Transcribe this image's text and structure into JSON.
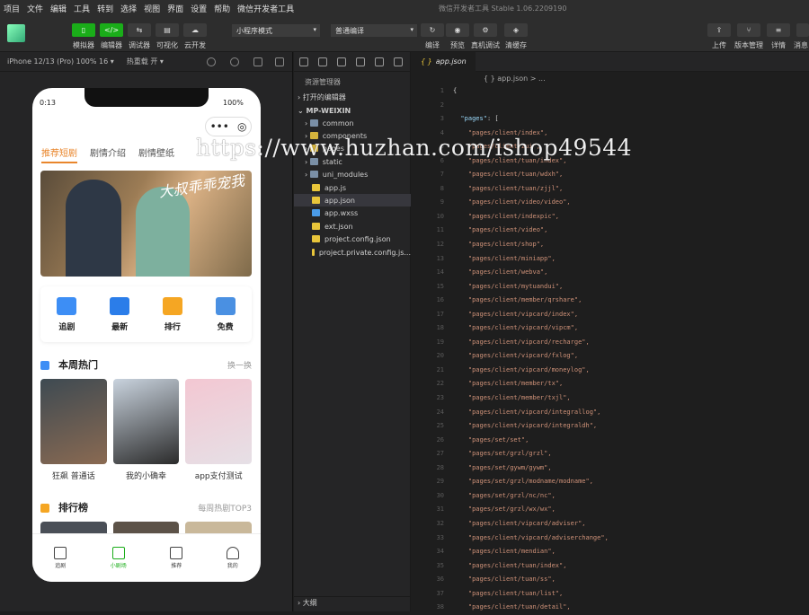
{
  "menu": [
    "项目",
    "文件",
    "编辑",
    "工具",
    "转到",
    "选择",
    "视图",
    "界面",
    "设置",
    "帮助",
    "微信开发者工具"
  ],
  "window_title": "微信开发者工具 Stable 1.06.2209190",
  "toolbar": {
    "left_labels": [
      "模拟器",
      "编辑器",
      "调试器",
      "可视化",
      "云开发"
    ],
    "mode_select": "小程序模式",
    "compile_select": "普通编译",
    "mid_labels": [
      "编译",
      "预览",
      "真机调试",
      "清缓存"
    ],
    "right_labels": [
      "上传",
      "版本管理",
      "详情",
      "消息"
    ]
  },
  "simulator": {
    "device": "iPhone 12/13 (Pro) 100% 16 ▾",
    "hot_reload": "热重载 开 ▾",
    "time": "0:13",
    "battery": "100%",
    "tabs": [
      "推荐短剧",
      "剧情介绍",
      "剧情壁纸"
    ],
    "banner_text": "大叔乖乖宠我",
    "quick": [
      {
        "label": "追剧",
        "color": "#3d8ef5"
      },
      {
        "label": "最新",
        "color": "#2b7de9"
      },
      {
        "label": "排行",
        "color": "#f5a623"
      },
      {
        "label": "免费",
        "color": "#4a90e2"
      }
    ],
    "weekly_title": "本周热门",
    "weekly_more": "换一换",
    "cards": [
      {
        "caption": "狂飙 普通话",
        "c1": "#3e4a52",
        "c2": "#8a6a52"
      },
      {
        "caption": "我的小确幸",
        "c1": "#c9d3de",
        "c2": "#2b2b2b"
      },
      {
        "caption": "app支付测试",
        "c1": "#f3c7d2",
        "c2": "#e6e0e6"
      }
    ],
    "rank_title": "排行榜",
    "rank_more": "每周热剧TOP3",
    "tabbar": [
      "追剧",
      "小剧场",
      "推荐",
      "我的"
    ]
  },
  "explorer": {
    "title": "资源管理器",
    "open_editors": "打开的编辑器",
    "project": "MP-WEIXIN",
    "items": [
      {
        "name": "common",
        "type": "folder",
        "color": "#7a8fa6"
      },
      {
        "name": "components",
        "type": "folder",
        "color": "#d4b33c"
      },
      {
        "name": "pages",
        "type": "folder",
        "color": "#d4b33c"
      },
      {
        "name": "static",
        "type": "folder",
        "color": "#7a8fa6"
      },
      {
        "name": "uni_modules",
        "type": "folder",
        "color": "#7a8fa6"
      },
      {
        "name": "app.js",
        "type": "file",
        "color": "#e8c53a"
      },
      {
        "name": "app.json",
        "type": "file",
        "color": "#e8c53a"
      },
      {
        "name": "app.wxss",
        "type": "file",
        "color": "#4a9be8"
      },
      {
        "name": "ext.json",
        "type": "file",
        "color": "#e8c53a"
      },
      {
        "name": "project.config.json",
        "type": "file",
        "color": "#e8c53a"
      },
      {
        "name": "project.private.config.js...",
        "type": "file",
        "color": "#e8c53a"
      }
    ],
    "outline": "大纲"
  },
  "editor": {
    "tab": "app.json",
    "breadcrumb": "{ } app.json > ...",
    "lines": [
      "{",
      "",
      "  \"pages\": [",
      "    \"pages/client/index\",",
      "    \"pages/client/zui\",",
      "    \"pages/client/tuan/index\",",
      "    \"pages/client/tuan/wdxh\",",
      "    \"pages/client/tuan/zjjl\",",
      "    \"pages/client/video/video\",",
      "    \"pages/client/indexpic\",",
      "    \"pages/client/video\",",
      "    \"pages/client/shop\",",
      "    \"pages/client/miniapp\",",
      "    \"pages/client/webva\",",
      "    \"pages/client/mytuandui\",",
      "    \"pages/client/member/qrshare\",",
      "    \"pages/client/vipcard/index\",",
      "    \"pages/client/vipcard/vipcm\",",
      "    \"pages/client/vipcard/recharge\",",
      "    \"pages/client/vipcard/fxlog\",",
      "    \"pages/client/vipcard/moneylog\",",
      "    \"pages/client/member/tx\",",
      "    \"pages/client/member/txjl\",",
      "    \"pages/client/vipcard/integrallog\",",
      "    \"pages/client/vipcard/integraldh\",",
      "    \"pages/set/set\",",
      "    \"pages/set/grzl/grzl\",",
      "    \"pages/set/gywm/gywm\",",
      "    \"pages/set/grzl/modname/modname\",",
      "    \"pages/set/grzl/nc/nc\",",
      "    \"pages/set/grzl/wx/wx\",",
      "    \"pages/client/vipcard/adviser\",",
      "    \"pages/client/vipcard/adviserchange\",",
      "    \"pages/client/mendian\",",
      "    \"pages/client/tuan/index\",",
      "    \"pages/client/tuan/ss\",",
      "    \"pages/client/tuan/list\",",
      "    \"pages/client/tuan/detail\","
    ]
  },
  "watermark": "https://www.huzhan.com/ishop49544"
}
